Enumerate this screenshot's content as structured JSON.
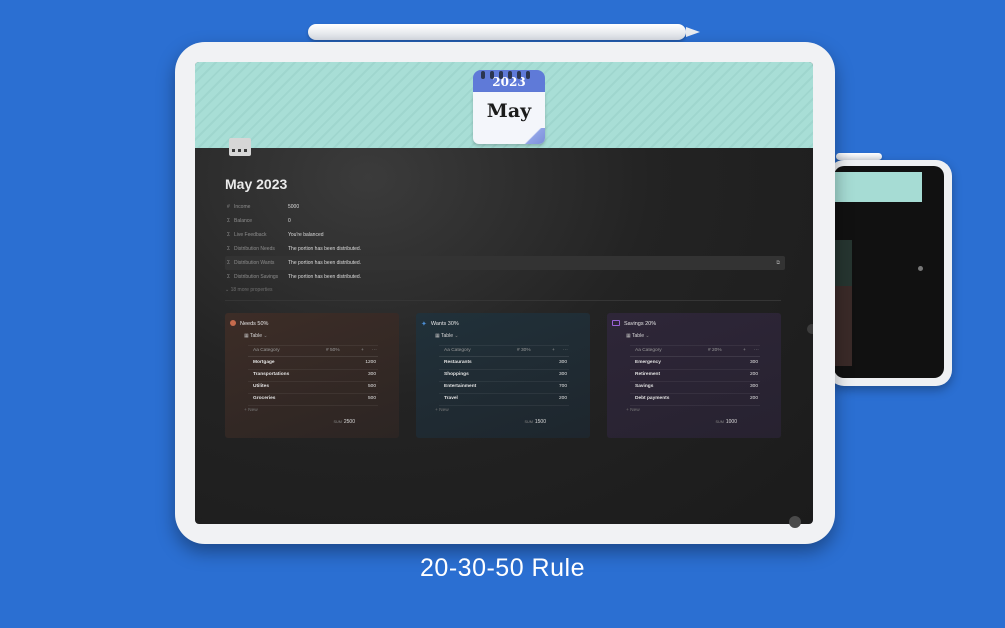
{
  "caption": "20-30-50 Rule",
  "calendar": {
    "year": "2023",
    "month": "May"
  },
  "page": {
    "title": "May 2023"
  },
  "properties": [
    {
      "icon": "number-icon",
      "name": "Income",
      "value": "5000",
      "highlight": false
    },
    {
      "icon": "formula-icon",
      "name": "Balance",
      "value": "0",
      "highlight": false
    },
    {
      "icon": "formula-icon",
      "name": "Live Feedback",
      "value": "You're balanced",
      "highlight": false
    },
    {
      "icon": "formula-icon",
      "name": "Distribution Needs",
      "value": "The portion has been distributed.",
      "highlight": false
    },
    {
      "icon": "formula-icon",
      "name": "Distribution Wants",
      "value": "The portion has been distributed.",
      "highlight": true
    },
    {
      "icon": "formula-icon",
      "name": "Distribution Savings",
      "value": "The portion has been distributed.",
      "highlight": false
    }
  ],
  "more_properties": "18 more properties",
  "colors": {
    "needs": "#3a2c27",
    "wants": "#1e2b33",
    "savings": "#2b2434",
    "needs_icon": "#c66b4d",
    "wants_icon": "#4d8fd6",
    "savings_icon": "#9a63d6"
  },
  "cards": [
    {
      "title": "Needs 50%",
      "icon": "circle-icon",
      "view": "Table",
      "col_category": "Category",
      "col_amount": "50%",
      "rows": [
        {
          "name": "Mortgage",
          "value": "1200"
        },
        {
          "name": "Transportations",
          "value": "300"
        },
        {
          "name": "Utilites",
          "value": "500"
        },
        {
          "name": "Groceries",
          "value": "500"
        }
      ],
      "new_label": "New",
      "sum_label": "SUM",
      "sum": "2500"
    },
    {
      "title": "Wants 30%",
      "icon": "sparkle-icon",
      "view": "Table",
      "col_category": "Category",
      "col_amount": "30%",
      "rows": [
        {
          "name": "Restaurants",
          "value": "300"
        },
        {
          "name": "Shoppings",
          "value": "300"
        },
        {
          "name": "Entertainment",
          "value": "700"
        },
        {
          "name": "Travel",
          "value": "200"
        }
      ],
      "new_label": "New",
      "sum_label": "SUM",
      "sum": "1500"
    },
    {
      "title": "Savings 20%",
      "icon": "money-icon",
      "view": "Table",
      "col_category": "Category",
      "col_amount": "20%",
      "rows": [
        {
          "name": "Emergency",
          "value": "300"
        },
        {
          "name": "Retirement",
          "value": "200"
        },
        {
          "name": "Savings",
          "value": "300"
        },
        {
          "name": "Debt payments",
          "value": "200"
        }
      ],
      "new_label": "New",
      "sum_label": "SUM",
      "sum": "1000"
    }
  ]
}
